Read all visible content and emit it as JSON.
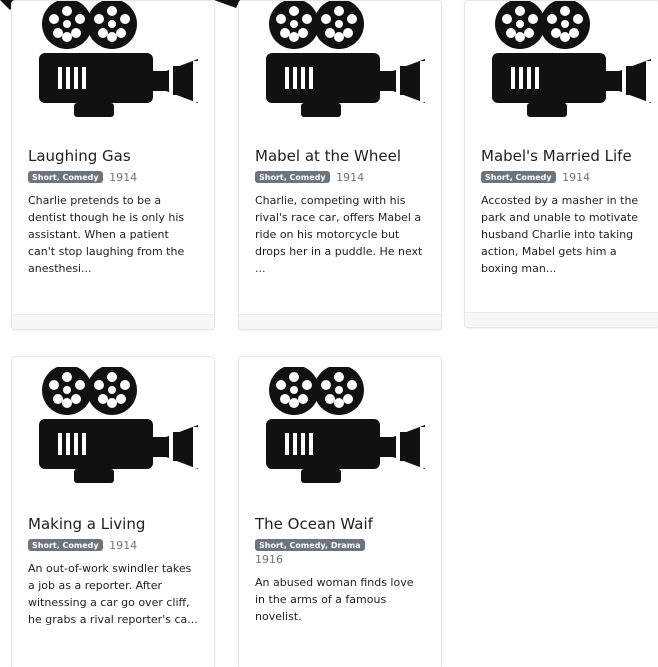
{
  "top": {
    "partial_year": "1916"
  },
  "cards": [
    {
      "title": "Laughing Gas",
      "genre": "Short, Comedy",
      "year": "1914",
      "description": "Charlie pretends to be a dentist though he is only his assistant. When a patient can't stop laughing from the anesthesi..."
    },
    {
      "title": "Mabel at the Wheel",
      "genre": "Short, Comedy",
      "year": "1914",
      "description": "Charlie, competing with his rival's race car, offers Mabel a ride on his motorcycle but drops her in a puddle. He next ..."
    },
    {
      "title": "Mabel's Married Life",
      "genre": "Short, Comedy",
      "year": "1914",
      "description": "Accosted by a masher in the park and unable to motivate husband Charlie into taking action, Mabel gets him a boxing man..."
    },
    {
      "title": "Making a Living",
      "genre": "Short, Comedy",
      "year": "1914",
      "description": "An out-of-work swindler takes a job as a reporter. After witnessing a car go over cliff, he grabs a rival reporter's ca..."
    },
    {
      "title": "The Ocean Waif",
      "genre": "Short, Comedy, Drama",
      "year": "1916",
      "description": "An abused woman finds love in the arms of a famous novelist."
    }
  ]
}
